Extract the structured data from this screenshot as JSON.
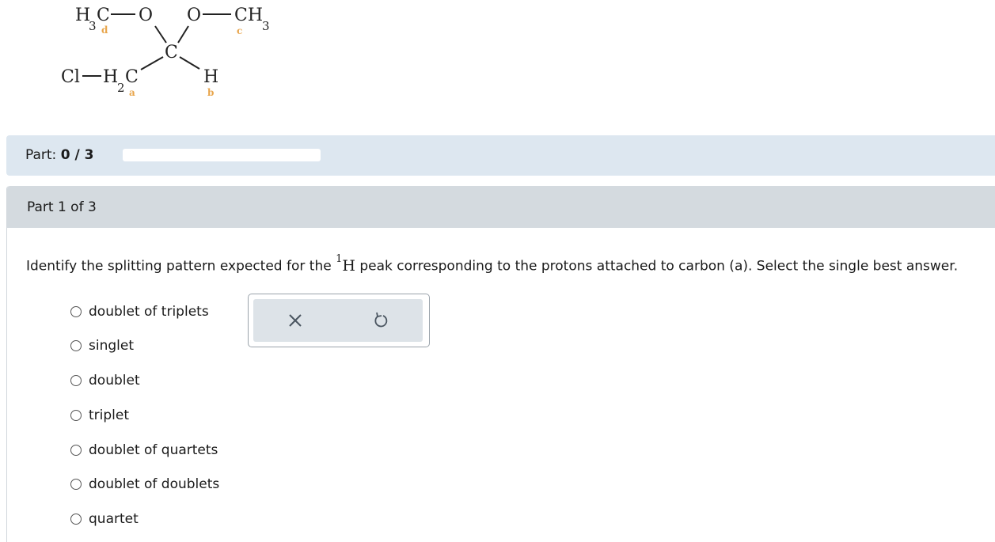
{
  "molecule": {
    "h3c_d": "H",
    "h3c_d_sub": "3",
    "h3c_d_c": "C",
    "o_left": "O",
    "o_right": "O",
    "ch3_c": "CH",
    "ch3_c_sub": "3",
    "center_c": "C",
    "cl": "Cl",
    "h2c_h": "H",
    "h2c_sub": "2",
    "h2c_c": "C",
    "h_b": "H",
    "labels": {
      "a": "a",
      "b": "b",
      "c": "c",
      "d": "d"
    }
  },
  "part_bar": {
    "label": "Part:",
    "progress_text": "0 / 3",
    "progress_fraction": 0
  },
  "part": {
    "header": "Part 1 of 3",
    "question_before": "Identify the splitting pattern expected for the ",
    "question_sup": "1",
    "question_nucleus": "H",
    "question_after": " peak corresponding to the protons attached to carbon (a). Select the single best answer.",
    "options": [
      "doublet of triplets",
      "singlet",
      "doublet",
      "triplet",
      "doublet of quartets",
      "doublet of doublets",
      "quartet"
    ],
    "selected_option": null
  },
  "tools": {
    "clear_icon": "close-icon",
    "reset_icon": "undo-icon"
  }
}
